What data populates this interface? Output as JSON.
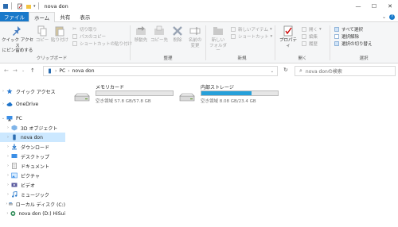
{
  "window": {
    "title": "nova don"
  },
  "tabs": [
    {
      "label": "ファイル"
    },
    {
      "label": "ホーム"
    },
    {
      "label": "共有"
    },
    {
      "label": "表示"
    }
  ],
  "ribbon": {
    "clipboard": {
      "pin": "クイック アクセス\nにピン留めする",
      "copy": "コピー",
      "paste": "貼り付け",
      "cut": "切り取り",
      "copy_path": "パスのコピー",
      "paste_shortcut": "ショートカットの貼り付け",
      "label": "クリップボード"
    },
    "organize": {
      "move": "移動先",
      "copyto": "コピー先",
      "delete": "削除",
      "rename": "名前の\n変更",
      "label": "整理"
    },
    "new": {
      "newfolder": "新しい\nフォルダー",
      "newitem": "新しいアイテム",
      "shortcut": "ショートカット",
      "label": "新規"
    },
    "open": {
      "properties": "プロパティ",
      "open": "開く",
      "edit": "編集",
      "history": "履歴",
      "label": "開く"
    },
    "select": {
      "all": "すべて選択",
      "none": "選択解除",
      "invert": "選択の切り替え",
      "label": "選択"
    }
  },
  "address": {
    "path": [
      "PC",
      "nova don"
    ],
    "search_placeholder": "nova donの検索"
  },
  "nav": [
    {
      "label": "クイック アクセス",
      "icon": "star-icon",
      "arrow": "›"
    },
    {
      "label": "OneDrive",
      "icon": "cloud-icon",
      "arrow": "›"
    },
    {
      "label": "PC",
      "icon": "pc-icon",
      "arrow": "⌄"
    },
    {
      "label": "3D オブジェクト",
      "icon": "cube-icon",
      "arrow": "›"
    },
    {
      "label": "nova don",
      "icon": "phone-icon",
      "arrow": "›"
    },
    {
      "label": "ダウンロード",
      "icon": "download-icon",
      "arrow": "›"
    },
    {
      "label": "デスクトップ",
      "icon": "desktop-icon",
      "arrow": "›"
    },
    {
      "label": "ドキュメント",
      "icon": "document-icon",
      "arrow": "›"
    },
    {
      "label": "ピクチャ",
      "icon": "picture-icon",
      "arrow": "›"
    },
    {
      "label": "ビデオ",
      "icon": "video-icon",
      "arrow": "›"
    },
    {
      "label": "ミュージック",
      "icon": "music-icon",
      "arrow": "›"
    },
    {
      "label": "ローカル ディスク (C:)",
      "icon": "disk-icon",
      "arrow": "›"
    },
    {
      "label": "nova don (D:) HiSui",
      "icon": "hisui-icon",
      "arrow": "›"
    }
  ],
  "drives": [
    {
      "name": "メモリカード",
      "info": "空き領域 57.8 GB/57.8 GB",
      "used_fraction": 0.0
    },
    {
      "name": "内部ストレージ",
      "info": "空き領域 8.08 GB/23.4 GB",
      "used_fraction": 0.655
    }
  ],
  "colors": {
    "accent": "#1979ca",
    "selection": "#cce8ff",
    "bar_fill": "#26a0da"
  }
}
